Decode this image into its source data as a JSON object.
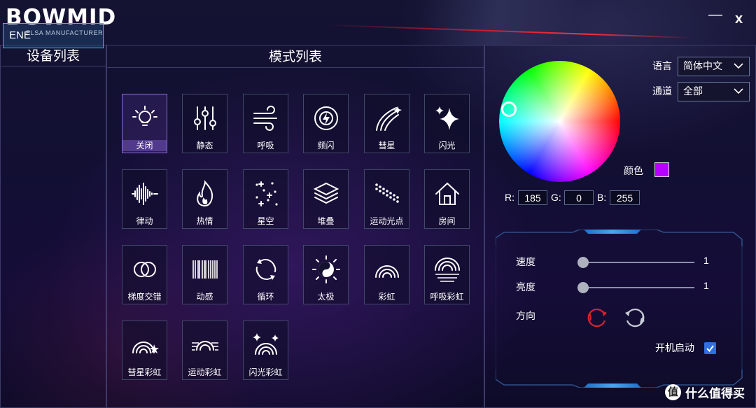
{
  "app": {
    "logo": "BOWMID",
    "logo_sub": "ELSA MANUFACTURER",
    "minimize": "—",
    "close": "x"
  },
  "devices": {
    "title": "设备列表",
    "items": [
      "ENE"
    ]
  },
  "modes": {
    "title": "模式列表",
    "items": [
      {
        "label": "关闭",
        "icon": "bulb-icon",
        "selected": true
      },
      {
        "label": "静态",
        "icon": "sliders-icon"
      },
      {
        "label": "呼吸",
        "icon": "wind-icon"
      },
      {
        "label": "频闪",
        "icon": "flash-icon"
      },
      {
        "label": "彗星",
        "icon": "comet-icon"
      },
      {
        "label": "闪光",
        "icon": "sparkle-icon"
      },
      {
        "label": "律动",
        "icon": "waveform-icon"
      },
      {
        "label": "热情",
        "icon": "flame-icon"
      },
      {
        "label": "星空",
        "icon": "stars-icon"
      },
      {
        "label": "堆叠",
        "icon": "layers-icon"
      },
      {
        "label": "运动光点",
        "icon": "moving-dots-icon"
      },
      {
        "label": "房间",
        "icon": "house-icon"
      },
      {
        "label": "梯度交错",
        "icon": "rings-icon"
      },
      {
        "label": "动感",
        "icon": "barcode-icon"
      },
      {
        "label": "循环",
        "icon": "cycle-icon"
      },
      {
        "label": "太极",
        "icon": "yin-yang-icon"
      },
      {
        "label": "彩虹",
        "icon": "rainbow-icon"
      },
      {
        "label": "呼吸彩虹",
        "icon": "breathing-rainbow-icon"
      },
      {
        "label": "彗星彩虹",
        "icon": "comet-rainbow-icon"
      },
      {
        "label": "运动彩虹",
        "icon": "moving-rainbow-icon"
      },
      {
        "label": "闪光彩虹",
        "icon": "sparkle-rainbow-icon"
      }
    ]
  },
  "settings": {
    "language_label": "语言",
    "language_value": "简体中文",
    "channel_label": "通道",
    "channel_value": "全部",
    "color_label": "颜色",
    "color_hex": "#b900ff",
    "r_label": "R:",
    "r": "185",
    "g_label": "G:",
    "g": "0",
    "b_label": "B:",
    "b": "255",
    "speed_label": "速度",
    "speed_value": "1",
    "brightness_label": "亮度",
    "brightness_value": "1",
    "direction_label": "方向",
    "boot_label": "开机启动",
    "boot_checked": true
  },
  "watermark": {
    "logo": "值",
    "text": "什么值得买"
  },
  "colors": {
    "accent": "#3db8d8",
    "selected_tile": "#8c6cd8",
    "checkbox": "#2f6fe0",
    "dir_ccw": "#d42430",
    "dir_cw": "#c8ccd6"
  }
}
